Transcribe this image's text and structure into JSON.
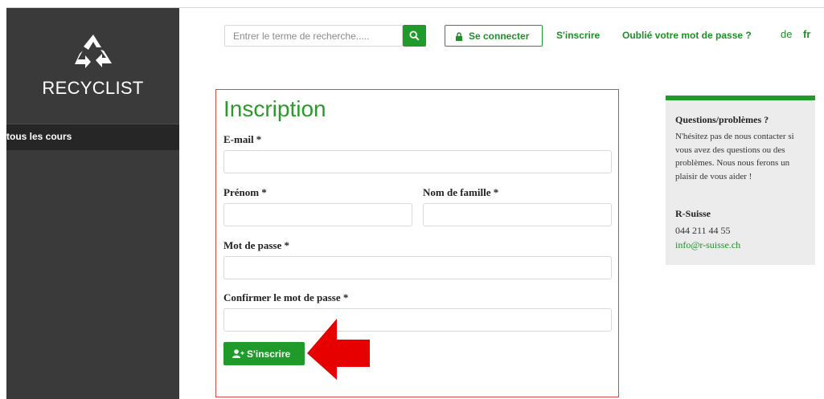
{
  "sidebar": {
    "logo_text": "RECYCLIST",
    "nav_item": "tous les cours"
  },
  "header": {
    "search_placeholder": "Entrer le terme de recherche.....",
    "login_label": "Se connecter",
    "register_link": "S'inscrire",
    "forgot_link": "Oublié votre mot de passe ?",
    "lang_de": "de",
    "lang_fr": "fr"
  },
  "form": {
    "title": "Inscription",
    "email_label": "E-mail *",
    "firstname_label": "Prénom *",
    "lastname_label": "Nom de famille *",
    "password_label": "Mot de passe *",
    "confirm_label": "Confirmer le mot de passe *",
    "submit_label": "S'inscrire"
  },
  "help": {
    "title": "Questions/problèmes ?",
    "text": "N'hésitez pas de nous contacter si vous avez des questions ou des problèmes. Nous nous ferons un plaisir de vous aider !",
    "org": "R-Suisse",
    "phone": "044 211 44 55",
    "email": "info@r-suisse.ch"
  },
  "colors": {
    "accent": "#1f9a2b",
    "sidebar": "#3a3a3a",
    "annotation": "#e60000"
  },
  "icons": [
    "recycle-icon",
    "search-icon",
    "lock-icon",
    "user-plus-icon",
    "red-arrow-icon"
  ]
}
